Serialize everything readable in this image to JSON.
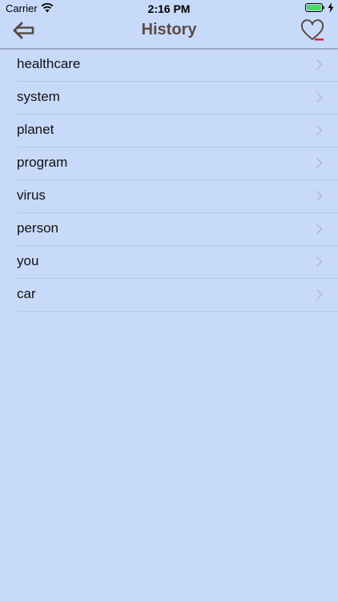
{
  "status": {
    "carrier": "Carrier",
    "time": "2:16 PM"
  },
  "nav": {
    "title": "History",
    "back_icon": "back-arrow-icon",
    "favorites_icon": "heart-minus-icon"
  },
  "history": [
    {
      "label": "healthcare"
    },
    {
      "label": "system"
    },
    {
      "label": "planet"
    },
    {
      "label": "program"
    },
    {
      "label": "virus"
    },
    {
      "label": "person"
    },
    {
      "label": "you"
    },
    {
      "label": "car"
    }
  ],
  "colors": {
    "background": "#c8dafa",
    "title": "#5a4b46",
    "icon": "#5a4b46",
    "accent_red": "#e5222b",
    "battery": "#4cd964"
  }
}
